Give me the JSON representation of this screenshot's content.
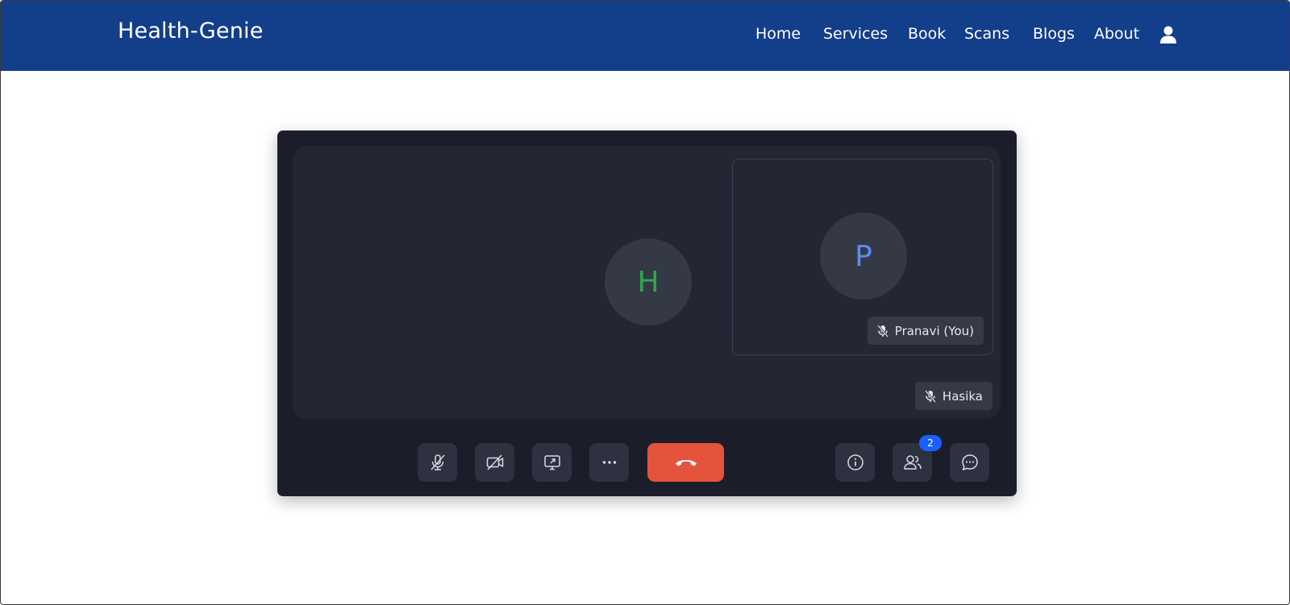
{
  "brand": "Health-Genie",
  "nav": {
    "items": [
      {
        "label": "Home"
      },
      {
        "label": "Services"
      },
      {
        "label": "Book"
      },
      {
        "label": "Scans"
      },
      {
        "label": "Blogs"
      },
      {
        "label": "About"
      }
    ],
    "profile_icon": "user-icon"
  },
  "meeting": {
    "remote": {
      "initial": "H",
      "name": "Hasika",
      "muted": true
    },
    "self": {
      "initial": "P",
      "name": "Pranavi (You)",
      "muted": true
    },
    "controls": {
      "left": [
        "mic-off-icon",
        "camera-off-icon",
        "screen-share-icon",
        "more-icon"
      ],
      "end_call_icon": "phone-hangup-icon",
      "right": [
        "info-icon",
        "participants-icon",
        "chat-icon"
      ]
    },
    "participants_count": "2"
  },
  "colors": {
    "navbar": "#133e8a",
    "meeting_bg": "#1b1e2a",
    "tile_bg": "#242733",
    "avatar_bg": "#353946",
    "initial_h": "#2ea84a",
    "initial_p": "#5b8def",
    "end_call": "#e5533d",
    "badge": "#1a5fff"
  }
}
